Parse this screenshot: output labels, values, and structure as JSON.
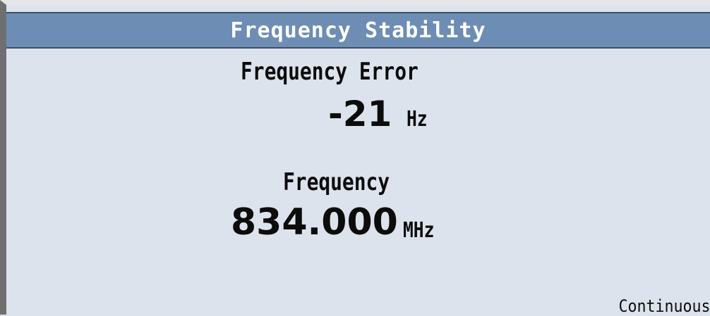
{
  "header": {
    "title": "Frequency Stability"
  },
  "frequency_error": {
    "label": "Frequency Error",
    "value": "-21",
    "unit": "Hz"
  },
  "frequency": {
    "label": "Frequency",
    "value": "834.000",
    "unit": "MHz"
  },
  "status": {
    "mode": "Continuous"
  },
  "colors": {
    "title_bar": "#6d8db5",
    "background": "#dde3ec",
    "text": "#0c0c0c"
  }
}
